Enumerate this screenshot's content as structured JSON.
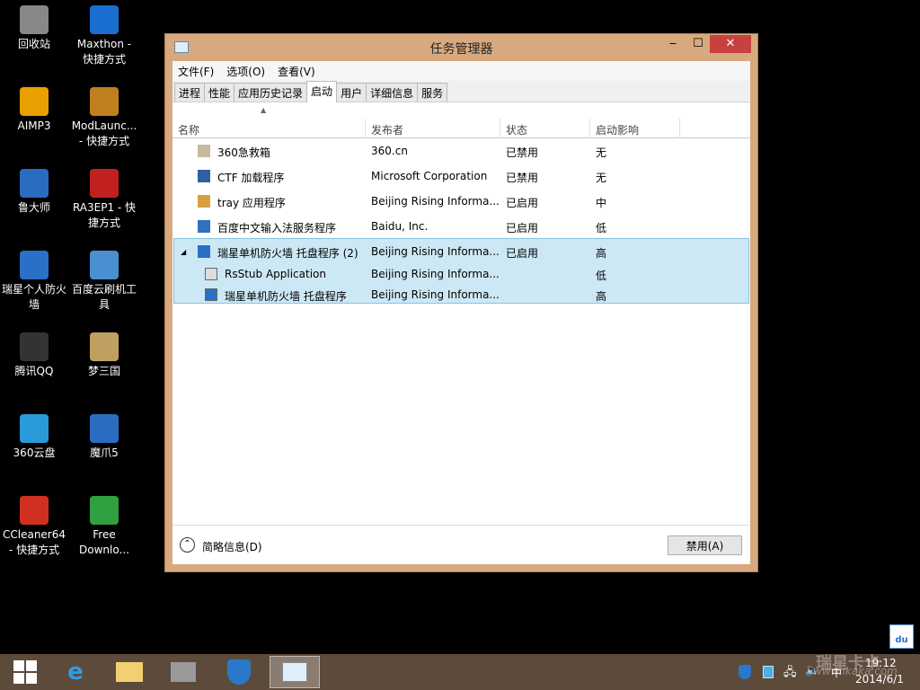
{
  "desktop": [
    {
      "label": "回收站",
      "icon": "recycle-bin-icon",
      "color": "#888"
    },
    {
      "label": "Maxthon - 快捷方式",
      "icon": "maxthon-icon",
      "color": "#1a6fd0"
    },
    {
      "label": "AIMP3",
      "icon": "aimp-icon",
      "color": "#e8a000"
    },
    {
      "label": "ModLaunc... - 快捷方式",
      "icon": "modlauncher-icon",
      "color": "#c08020"
    },
    {
      "label": "鲁大师",
      "icon": "ludashi-icon",
      "color": "#2a6cc0"
    },
    {
      "label": "RA3EP1 - 快捷方式",
      "icon": "ra3-icon",
      "color": "#c02020"
    },
    {
      "label": "瑞星个人防火墙",
      "icon": "rising-firewall-icon",
      "color": "#2a70c8"
    },
    {
      "label": "百度云刷机工具",
      "icon": "baidu-flash-icon",
      "color": "#4a90d0"
    },
    {
      "label": "腾讯QQ",
      "icon": "qq-icon",
      "color": "#333"
    },
    {
      "label": "梦三国",
      "icon": "game-icon",
      "color": "#c0a060"
    },
    {
      "label": "360云盘",
      "icon": "360-cloud-icon",
      "color": "#2a9ad8"
    },
    {
      "label": "魔爪5",
      "icon": "cloud-icon",
      "color": "#2a6cc0"
    },
    {
      "label": "CCleaner64 - 快捷方式",
      "icon": "ccleaner-icon",
      "color": "#d03020"
    },
    {
      "label": "Free Downlo...",
      "icon": "download-icon",
      "color": "#30a040"
    }
  ],
  "window": {
    "title": "任务管理器",
    "minimize": "‒",
    "maximize": "☐",
    "close": "✕"
  },
  "menu": [
    "文件(F)",
    "选项(O)",
    "查看(V)"
  ],
  "tabs": [
    "进程",
    "性能",
    "应用历史记录",
    "启动",
    "用户",
    "详细信息",
    "服务"
  ],
  "columns": [
    "名称",
    "发布者",
    "状态",
    "启动影响"
  ],
  "rows": [
    {
      "name": "360急救箱",
      "publisher": "360.cn",
      "status": "已禁用",
      "impact": "无",
      "color": "#c8b8a0"
    },
    {
      "name": "CTF 加载程序",
      "publisher": "Microsoft Corporation",
      "status": "已禁用",
      "impact": "无",
      "color": "#3060a0"
    },
    {
      "name": "tray 应用程序",
      "publisher": "Beijing Rising Informa...",
      "status": "已启用",
      "impact": "中",
      "color": "#d8a040"
    },
    {
      "name": "百度中文输入法服务程序",
      "publisher": "Baidu, Inc.",
      "status": "已启用",
      "impact": "低",
      "color": "#3070c0"
    },
    {
      "name": "瑞星单机防火墙 托盘程序 (2)",
      "publisher": "Beijing Rising Informa...",
      "status": "已启用",
      "impact": "高",
      "color": "#2a70c8"
    }
  ],
  "subrows": [
    {
      "name": "RsStub Application",
      "publisher": "Beijing Rising Informa...",
      "impact": "低"
    },
    {
      "name": "瑞星单机防火墙 托盘程序",
      "publisher": "Beijing Rising Informa...",
      "impact": "高"
    }
  ],
  "footer": {
    "less": "简略信息(D)",
    "disable": "禁用(A)"
  },
  "tray": {
    "time": "19:12",
    "date": "2014/6/1",
    "ime": "中",
    "watermark": "瑞星卡卡",
    "watermark_url": "www.ikaka.com"
  }
}
